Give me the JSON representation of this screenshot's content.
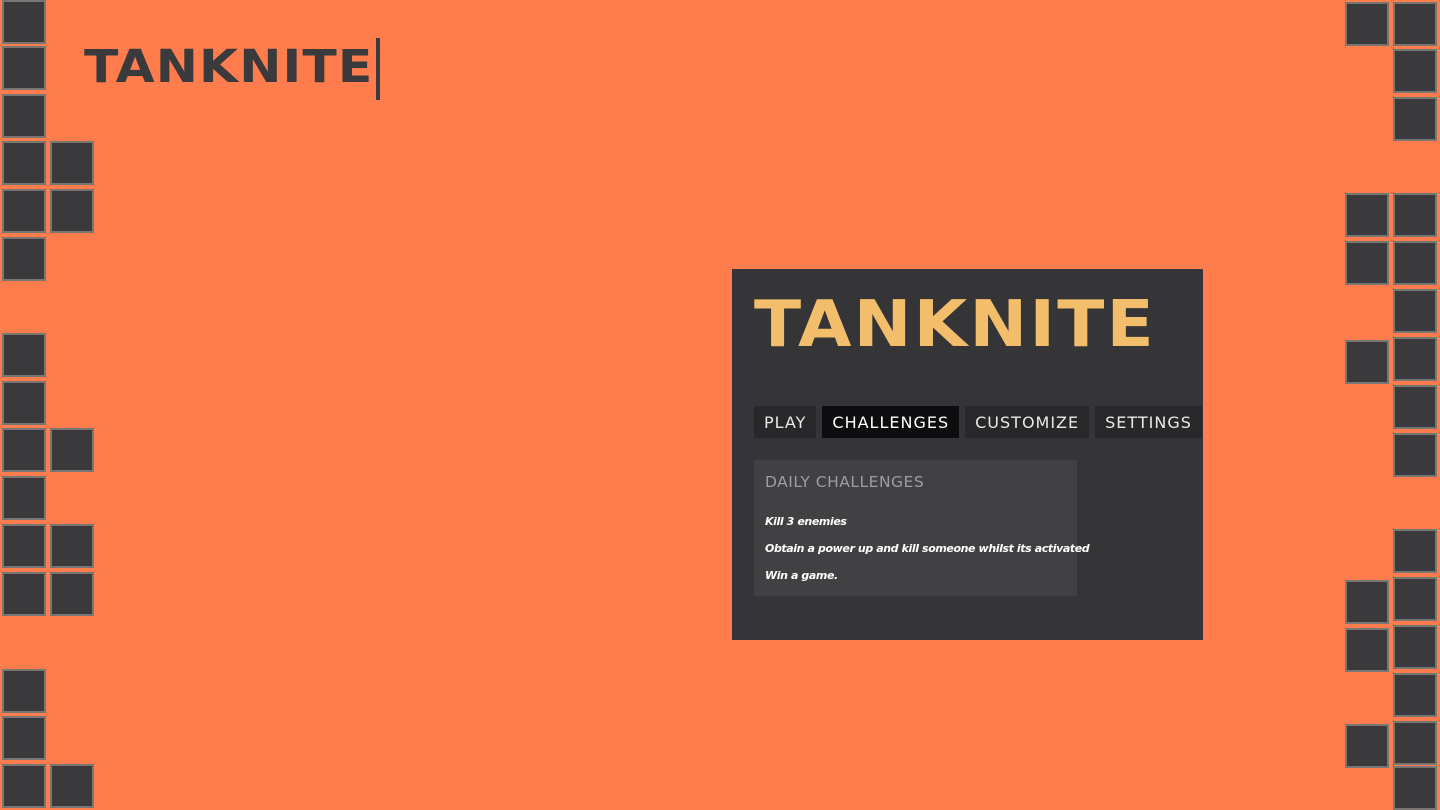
{
  "slide": {
    "logo_text": "TANKNITE"
  },
  "game": {
    "title": "TANKNITE",
    "menu": [
      {
        "label": "PLAY",
        "active": false
      },
      {
        "label": "CHALLENGES",
        "active": true
      },
      {
        "label": "CUSTOMIZE",
        "active": false
      },
      {
        "label": "SETTINGS",
        "active": false
      }
    ],
    "daily": {
      "heading": "DAILY CHALLENGES",
      "items": [
        "Kill 3 enemies",
        "Obtain a power up and kill someone whilst its activated",
        "Win a game."
      ]
    }
  },
  "colors": {
    "background": "#FF7C4D",
    "block": "#3A3A3C",
    "game_bg": "#353437",
    "game_title": "#F2BE6B",
    "active_tab": "#0D0D0F"
  }
}
